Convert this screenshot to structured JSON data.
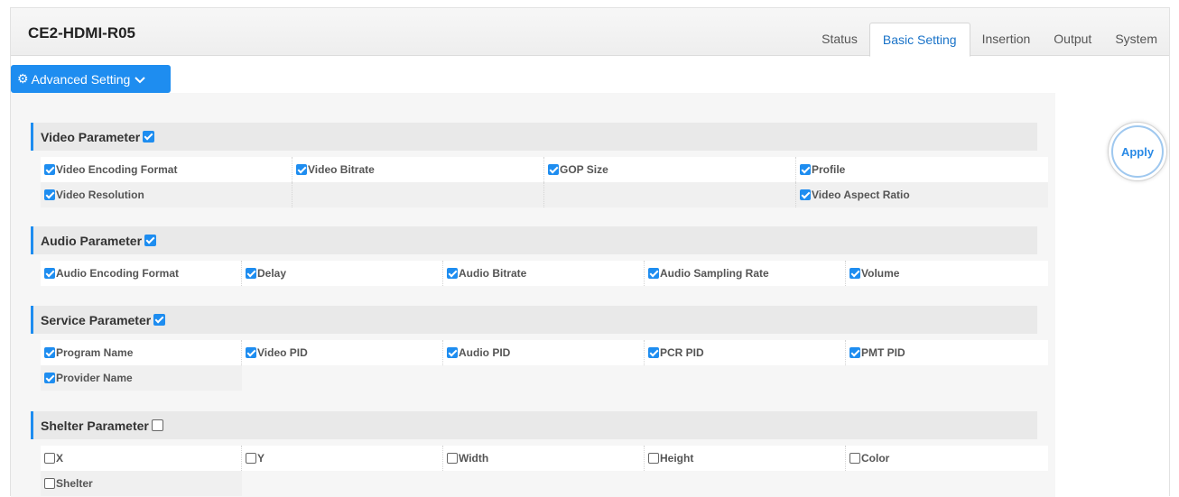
{
  "app": {
    "title": "CE2-HDMI-R05"
  },
  "tabs": [
    {
      "label": "Status",
      "active": false
    },
    {
      "label": "Basic Setting",
      "active": true
    },
    {
      "label": "Insertion",
      "active": false
    },
    {
      "label": "Output",
      "active": false
    },
    {
      "label": "System",
      "active": false
    }
  ],
  "advanced": {
    "label": "Advanced Setting",
    "icon": "gear-icon",
    "chevron": "chevron-down-icon"
  },
  "apply": {
    "label": "Apply"
  },
  "colors": {
    "accent": "#1e8df0",
    "apply_text": "#2a8ae6"
  },
  "sections": {
    "video": {
      "title": "Video Parameter",
      "checked": true,
      "items": [
        {
          "label": "Video Encoding Format",
          "checked": true
        },
        {
          "label": "Video Bitrate",
          "checked": true
        },
        {
          "label": "GOP Size",
          "checked": true
        },
        {
          "label": "Profile",
          "checked": true
        },
        {
          "label": "Video Resolution",
          "checked": true
        },
        {
          "label": "Video Aspect Ratio",
          "checked": true
        }
      ]
    },
    "audio": {
      "title": "Audio Parameter",
      "checked": true,
      "items": [
        {
          "label": "Audio Encoding Format",
          "checked": true
        },
        {
          "label": "Delay",
          "checked": true
        },
        {
          "label": "Audio Bitrate",
          "checked": true
        },
        {
          "label": "Audio Sampling Rate",
          "checked": true
        },
        {
          "label": "Volume",
          "checked": true
        }
      ]
    },
    "service": {
      "title": "Service Parameter",
      "checked": true,
      "items": [
        {
          "label": "Program Name",
          "checked": true
        },
        {
          "label": "Video PID",
          "checked": true
        },
        {
          "label": "Audio PID",
          "checked": true
        },
        {
          "label": "PCR PID",
          "checked": true
        },
        {
          "label": "PMT PID",
          "checked": true
        },
        {
          "label": "Provider Name",
          "checked": true
        }
      ]
    },
    "shelter": {
      "title": "Shelter Parameter",
      "checked": false,
      "items": [
        {
          "label": "X",
          "checked": false
        },
        {
          "label": "Y",
          "checked": false
        },
        {
          "label": "Width",
          "checked": false
        },
        {
          "label": "Height",
          "checked": false
        },
        {
          "label": "Color",
          "checked": false
        },
        {
          "label": "Shelter",
          "checked": false
        }
      ]
    }
  }
}
